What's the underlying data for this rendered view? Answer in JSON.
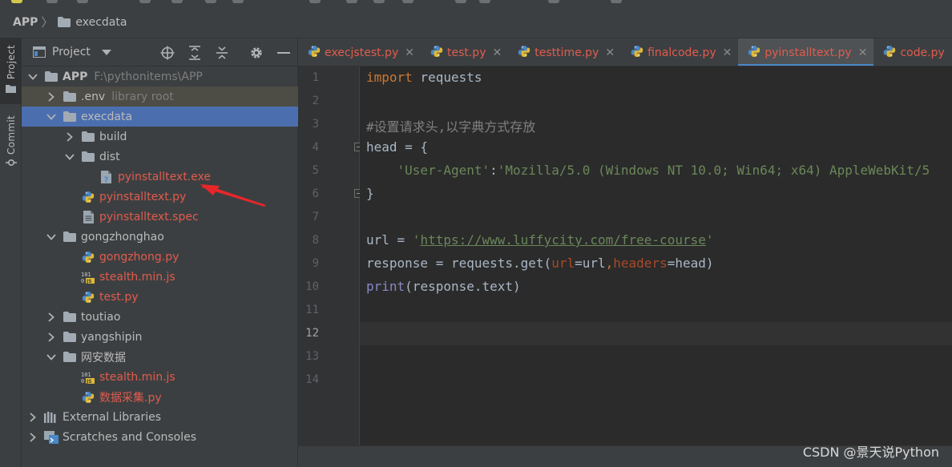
{
  "breadcrumb": {
    "root": "APP",
    "separator": "〉",
    "folder": "execdata"
  },
  "toolstrip": {
    "project_label": "Project",
    "commit_label": "Commit"
  },
  "project_panel": {
    "title": "Project",
    "tree": [
      {
        "label": "APP",
        "sub": "F:\\pythonitems\\APP",
        "depth": 0,
        "chevron": "down",
        "icon": "folder",
        "style": "bold"
      },
      {
        "label": ".env",
        "sub": "library root",
        "depth": 1,
        "chevron": "right",
        "icon": "folder",
        "style": "normal",
        "state": "dim"
      },
      {
        "label": "execdata",
        "depth": 1,
        "chevron": "down",
        "icon": "folder",
        "style": "normal",
        "state": "selected"
      },
      {
        "label": "build",
        "depth": 2,
        "chevron": "right",
        "icon": "folder",
        "style": "normal"
      },
      {
        "label": "dist",
        "depth": 2,
        "chevron": "down",
        "icon": "folder",
        "style": "normal"
      },
      {
        "label": "pyinstalltext.exe",
        "depth": 3,
        "chevron": "none",
        "icon": "unknown-file",
        "style": "red"
      },
      {
        "label": "pyinstalltext.py",
        "depth": 2,
        "chevron": "none",
        "icon": "python",
        "style": "red"
      },
      {
        "label": "pyinstalltext.spec",
        "depth": 2,
        "chevron": "none",
        "icon": "text-file",
        "style": "red"
      },
      {
        "label": "gongzhonghao",
        "depth": 1,
        "chevron": "down",
        "icon": "folder",
        "style": "normal"
      },
      {
        "label": "gongzhong.py",
        "depth": 2,
        "chevron": "none",
        "icon": "python",
        "style": "red"
      },
      {
        "label": "stealth.min.js",
        "depth": 2,
        "chevron": "none",
        "icon": "js-file",
        "style": "red"
      },
      {
        "label": "test.py",
        "depth": 2,
        "chevron": "none",
        "icon": "python",
        "style": "red"
      },
      {
        "label": "toutiao",
        "depth": 1,
        "chevron": "right",
        "icon": "folder",
        "style": "normal"
      },
      {
        "label": "yangshipin",
        "depth": 1,
        "chevron": "right",
        "icon": "folder",
        "style": "normal"
      },
      {
        "label": "网安数据",
        "depth": 1,
        "chevron": "down",
        "icon": "folder",
        "style": "normal"
      },
      {
        "label": "stealth.min.js",
        "depth": 2,
        "chevron": "none",
        "icon": "js-file",
        "style": "red"
      },
      {
        "label": "数据采集.py",
        "depth": 2,
        "chevron": "none",
        "icon": "python",
        "style": "red"
      },
      {
        "label": "External Libraries",
        "depth": 0,
        "chevron": "right",
        "icon": "libraries",
        "style": "normal"
      },
      {
        "label": "Scratches and Consoles",
        "depth": 0,
        "chevron": "right",
        "icon": "scratches",
        "style": "normal"
      }
    ]
  },
  "tabs": [
    {
      "label": "execjstest.py",
      "active": false
    },
    {
      "label": "test.py",
      "active": false
    },
    {
      "label": "testtime.py",
      "active": false
    },
    {
      "label": "finalcode.py",
      "active": false
    },
    {
      "label": "pyinstalltext.py",
      "active": true
    },
    {
      "label": "code.py",
      "active": false
    }
  ],
  "editor": {
    "line_numbers": [
      "1",
      "2",
      "3",
      "4",
      "5",
      "6",
      "7",
      "8",
      "9",
      "10",
      "11",
      "12",
      "13",
      "14"
    ],
    "current_line": "12",
    "code": {
      "l1_kw": "import",
      "l1_rest": " requests",
      "l3": "#设置请求头,以字典方式存放",
      "l4": "head = {",
      "l5_key": "'User-Agent'",
      "l5_colon": ":",
      "l5_val": "'Mozilla/5.0 (Windows NT 10.0; Win64; x64) AppleWebKit/5",
      "l6": "}",
      "l8_pre": "url = ",
      "l8_q1": "'",
      "l8_link": "https://www.luffycity.com/free-course",
      "l8_q2": "'",
      "l9_a": "response = requests.get(",
      "l9_p1": "url",
      "l9_b": "=url",
      "l9_c": ",",
      "l9_p2": "headers",
      "l9_d": "=head)",
      "l10_fn": "print",
      "l10_rest": "(response.text)"
    }
  },
  "watermark": "CSDN @景天说Python",
  "colors": {
    "accent_selection": "#4b6eaf",
    "modified_file": "#e05c4e",
    "annotation_arrow": "#e8262a"
  }
}
